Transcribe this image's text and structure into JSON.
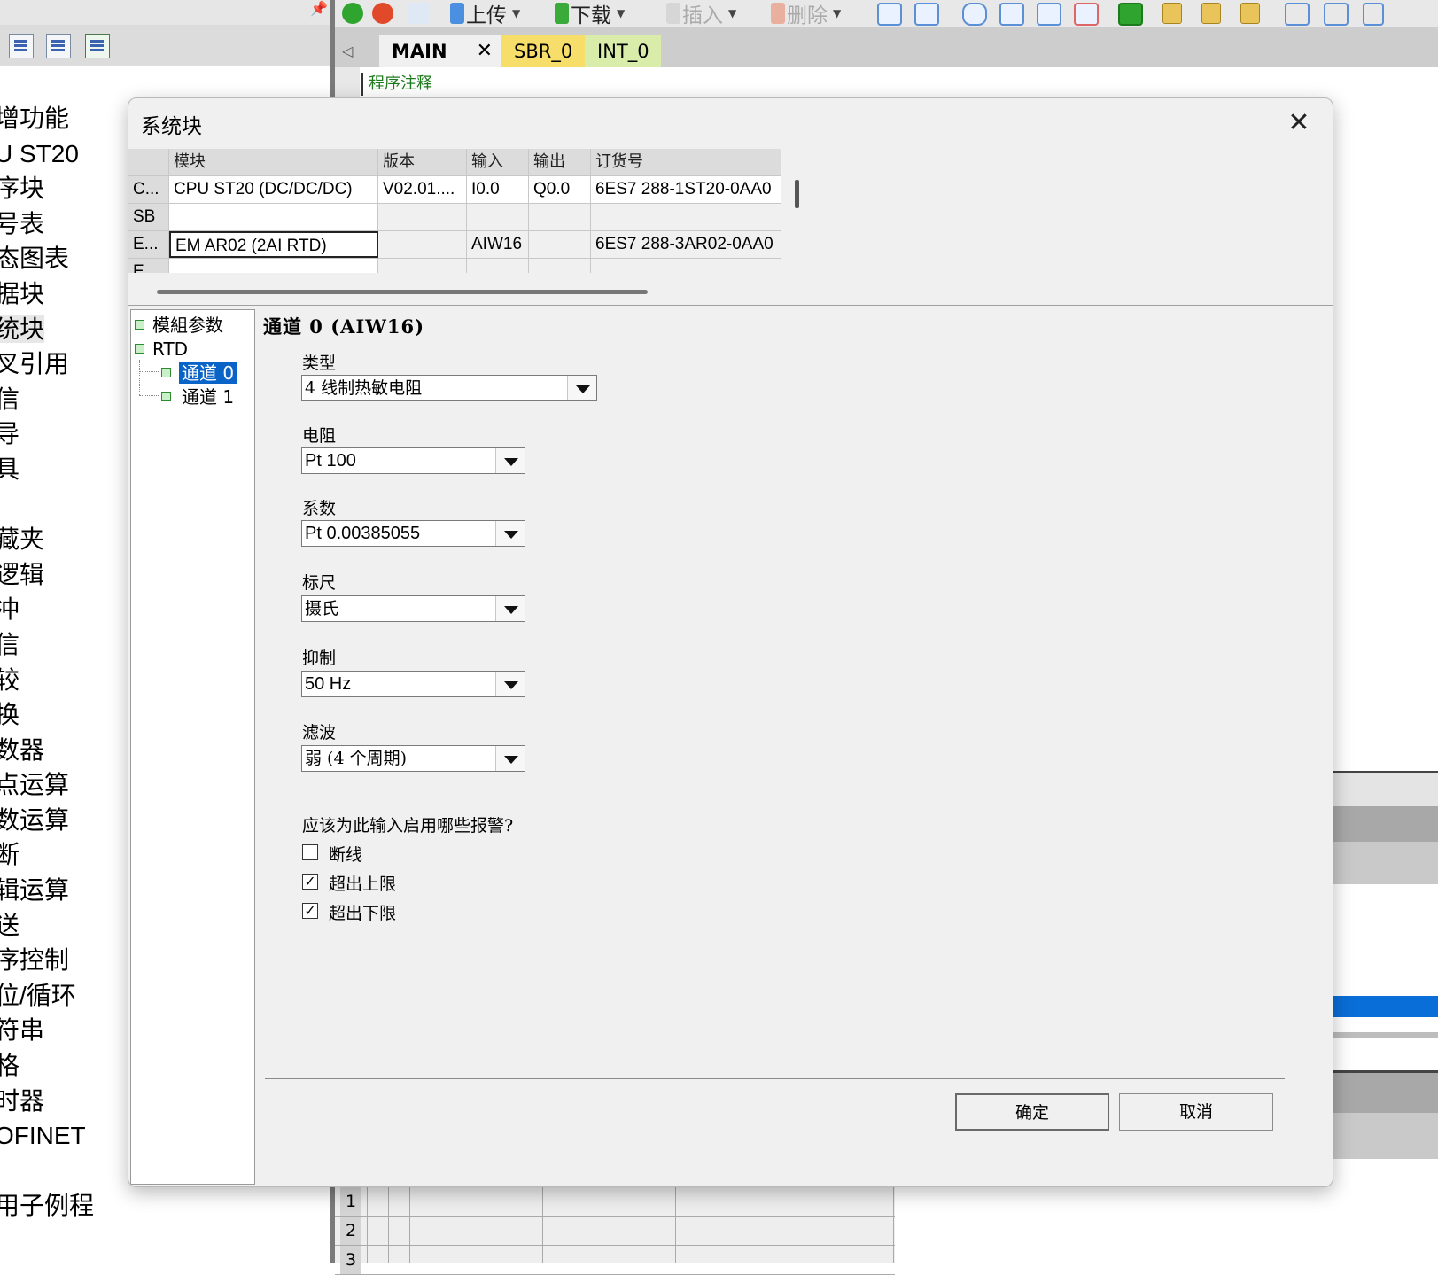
{
  "left_panel": {
    "items": [
      "增功能",
      "U ST20",
      "序块",
      "号表",
      "态图表",
      "据块",
      "统块",
      "叉引用",
      "信",
      "导",
      "具",
      "",
      "藏夹",
      "逻辑",
      "冲",
      "信",
      "较",
      "换",
      "数器",
      "点运算",
      "数运算",
      "断",
      "辑运算",
      "送",
      "序控制",
      "位/循环",
      "符串",
      "格",
      "时器",
      "OFINET",
      "",
      "用子例程"
    ]
  },
  "toolbar": {
    "upload": "上传",
    "download": "下载",
    "insert": "插入",
    "delete": "删除"
  },
  "tabs": [
    "MAIN",
    "SBR_0",
    "INT_0"
  ],
  "editor": {
    "comment": "程序注释",
    "grid_rows": [
      "1",
      "2",
      "3"
    ]
  },
  "dialog": {
    "title": "系统块",
    "table": {
      "headers": [
        "模块",
        "版本",
        "输入",
        "输出",
        "订货号"
      ],
      "rows": [
        {
          "head": "C...",
          "module": "CPU ST20 (DC/DC/DC)",
          "version": "V02.01....",
          "input": "I0.0",
          "output": "Q0.0",
          "order": "6ES7 288-1ST20-0AA0"
        },
        {
          "head": "SB",
          "module": "",
          "version": "",
          "input": "",
          "output": "",
          "order": ""
        },
        {
          "head": "E...",
          "module": "EM AR02 (2AI RTD)",
          "version": "",
          "input": "AIW16",
          "output": "",
          "order": "6ES7 288-3AR02-0AA0"
        },
        {
          "head": "E",
          "module": "",
          "version": "",
          "input": "",
          "output": "",
          "order": ""
        }
      ]
    },
    "tree": {
      "module_params": "模組参数",
      "rtd": "RTD",
      "channel0": "通道 0",
      "channel1": "通道 1"
    },
    "channel_title": "通道 0 (AIW16)",
    "fields": {
      "type_label": "类型",
      "type_value": "4 线制热敏电阻",
      "resistance_label": "电阻",
      "resistance_value": "Pt 100",
      "coefficient_label": "系数",
      "coefficient_value": "Pt 0.00385055",
      "scale_label": "标尺",
      "scale_value": "摄氏",
      "rejection_label": "抑制",
      "rejection_value": "50 Hz",
      "filter_label": "滤波",
      "filter_value": "弱 (4 个周期)"
    },
    "alarms": {
      "question": "应该为此输入启用哪些报警?",
      "wire_break": {
        "label": "断线",
        "checked": false
      },
      "upper_limit": {
        "label": "超出上限",
        "checked": true
      },
      "lower_limit": {
        "label": "超出下限",
        "checked": true
      }
    },
    "buttons": {
      "ok": "确定",
      "cancel": "取消"
    }
  },
  "colors": {
    "selection": "#0a64c8",
    "tab_sbr": "#f7dd6a",
    "tab_int": "#d9ecaa",
    "comment_green": "#1e7b1e"
  }
}
